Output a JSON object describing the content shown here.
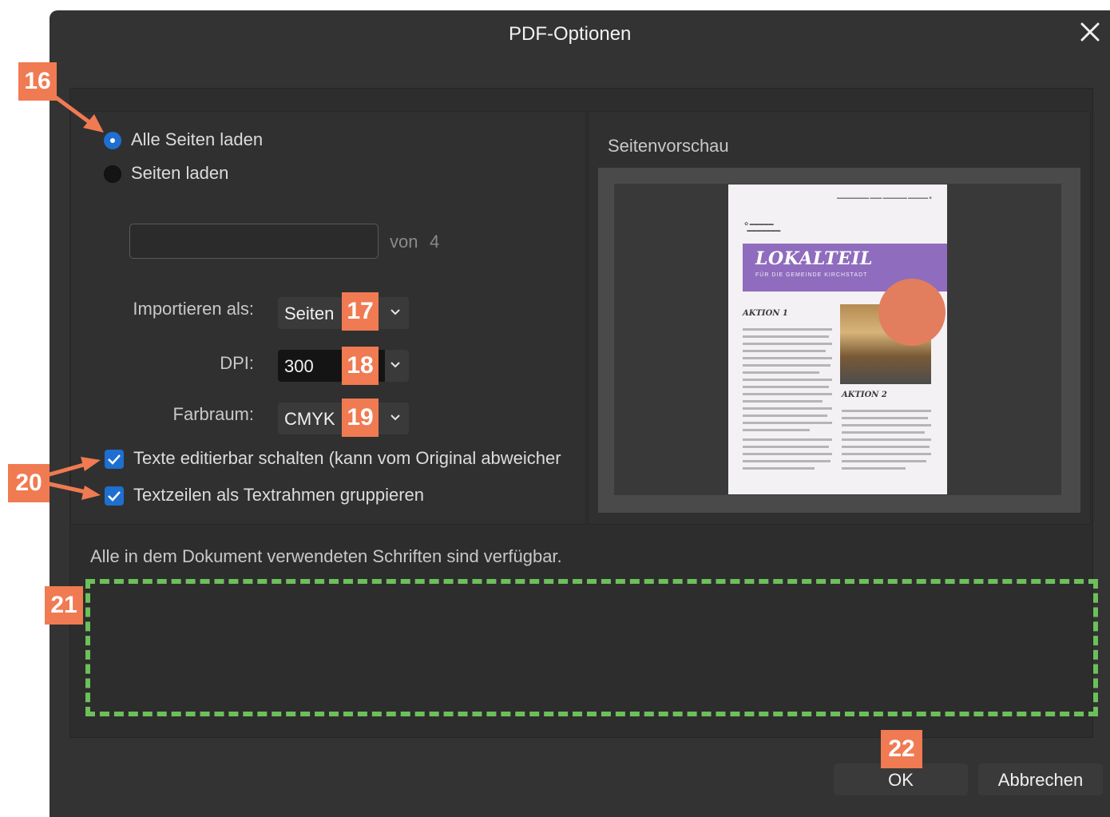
{
  "dialog": {
    "title": "PDF-Optionen",
    "close_icon": "close-icon"
  },
  "pages": {
    "all_pages_label": "Alle Seiten laden",
    "all_pages_selected": true,
    "range_label": "Seiten laden",
    "range_selected": false,
    "range_value": "",
    "of_label": "von",
    "page_count": "4"
  },
  "import_as": {
    "label": "Importieren als:",
    "value": "Seiten"
  },
  "dpi": {
    "label": "DPI:",
    "value": "300"
  },
  "colorspace": {
    "label": "Farbraum:",
    "value": "CMYK"
  },
  "options": {
    "editable_text_label": "Texte editierbar schalten (kann vom Original abweicher",
    "editable_text_checked": true,
    "group_lines_label": "Textzeilen als Textrahmen gruppieren",
    "group_lines_checked": true
  },
  "status_message": "Alle in dem Dokument verwendeten Schriften sind verfügbar.",
  "preview": {
    "label": "Seitenvorschau",
    "thumb_title": "LOKALTEIL",
    "thumb_subtitle": "FÜR DIE GEMEINDE KIRCHSTADT",
    "thumb_heading_1": "AKTION 1",
    "thumb_heading_2": "AKTION 2"
  },
  "buttons": {
    "ok": "OK",
    "cancel": "Abbrechen"
  },
  "markers": [
    "16",
    "17",
    "18",
    "19",
    "20",
    "21",
    "22"
  ],
  "colors": {
    "accent": "#1e6fd0",
    "marker": "#f07a52",
    "highlight": "#6cc05a",
    "dialog_bg": "#333333"
  }
}
